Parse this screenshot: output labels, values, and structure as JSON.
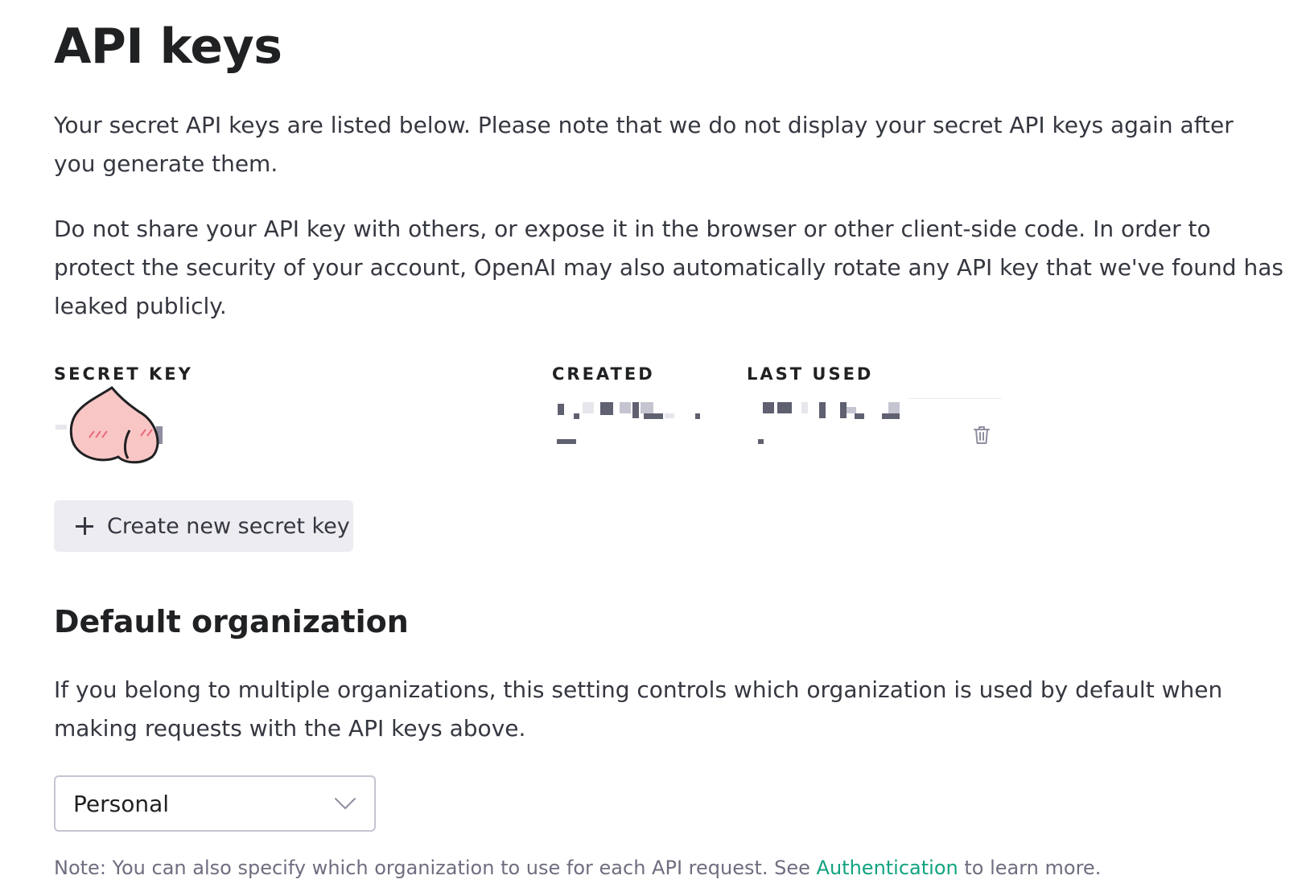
{
  "header": {
    "title": "API keys"
  },
  "intro": {
    "paragraph1": "Your secret API keys are listed below. Please note that we do not display your secret API keys again after you generate them.",
    "paragraph2": "Do not share your API key with others, or expose it in the browser or other client-side code. In order to protect the security of your account, OpenAI may also automatically rotate any API key that we've found has leaked publicly."
  },
  "keys_table": {
    "columns": {
      "secret_key": "SECRET KEY",
      "created": "CREATED",
      "last_used": "LAST USED"
    },
    "rows": [
      {
        "secret_key_icon": "peach-sticker-icon",
        "delete_icon": "trash-icon"
      }
    ]
  },
  "create_key_button": {
    "label": "Create new secret key",
    "icon": "plus-icon"
  },
  "default_org": {
    "title": "Default organization",
    "description": "If you belong to multiple organizations, this setting controls which organization is used by default when making requests with the API keys above.",
    "selected": "Personal",
    "dropdown_icon": "chevron-down-icon"
  },
  "note": {
    "prefix": "Note: You can also specify which organization to use for each API request. See",
    "link": "Authentication",
    "suffix": "to learn more."
  },
  "colors": {
    "text": "#353740",
    "heading": "#202123",
    "muted": "#6e6e80",
    "link": "#10a37f",
    "button_bg": "#ececf1",
    "border": "#c5c5d2"
  }
}
